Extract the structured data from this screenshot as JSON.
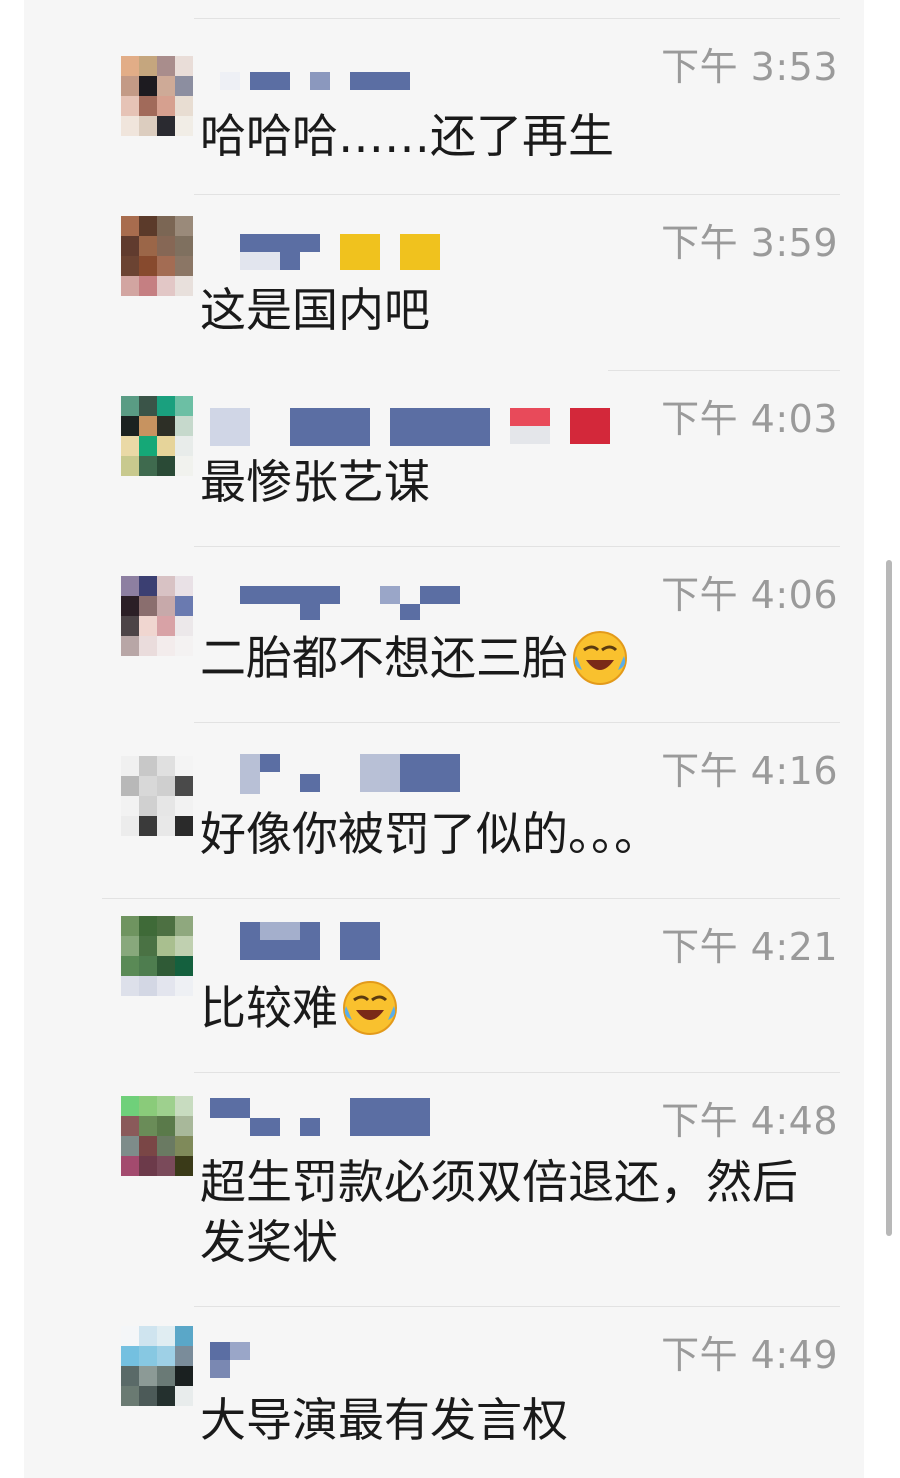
{
  "messages": [
    {
      "time": "下午 3:53",
      "text": "哈哈哈……还了再生",
      "emoji": false
    },
    {
      "time": "下午 3:59",
      "text": "这是国内吧",
      "emoji": false
    },
    {
      "time": "下午 4:03",
      "text": "最惨张艺谋",
      "emoji": false
    },
    {
      "time": "下午 4:06",
      "text": "二胎都不想还三胎",
      "emoji": true
    },
    {
      "time": "下午 4:16",
      "text": "好像你被罚了似的。。。",
      "emoji": false
    },
    {
      "time": "下午 4:21",
      "text": "比较难",
      "emoji": true
    },
    {
      "time": "下午 4:48",
      "text": "超生罚款必须双倍退还，然后发奖状",
      "emoji": false
    },
    {
      "time": "下午 4:49",
      "text": "大导演最有发言权",
      "emoji": false
    }
  ],
  "icons": {
    "emoji": "laughing-crying-face-icon",
    "avatar": "pixelated-avatar-icon"
  },
  "colors": {
    "name_blur": "#5b6ea3",
    "time": "#9a9a9a",
    "text": "#1a1a1a",
    "panel": "#f6f6f6"
  }
}
